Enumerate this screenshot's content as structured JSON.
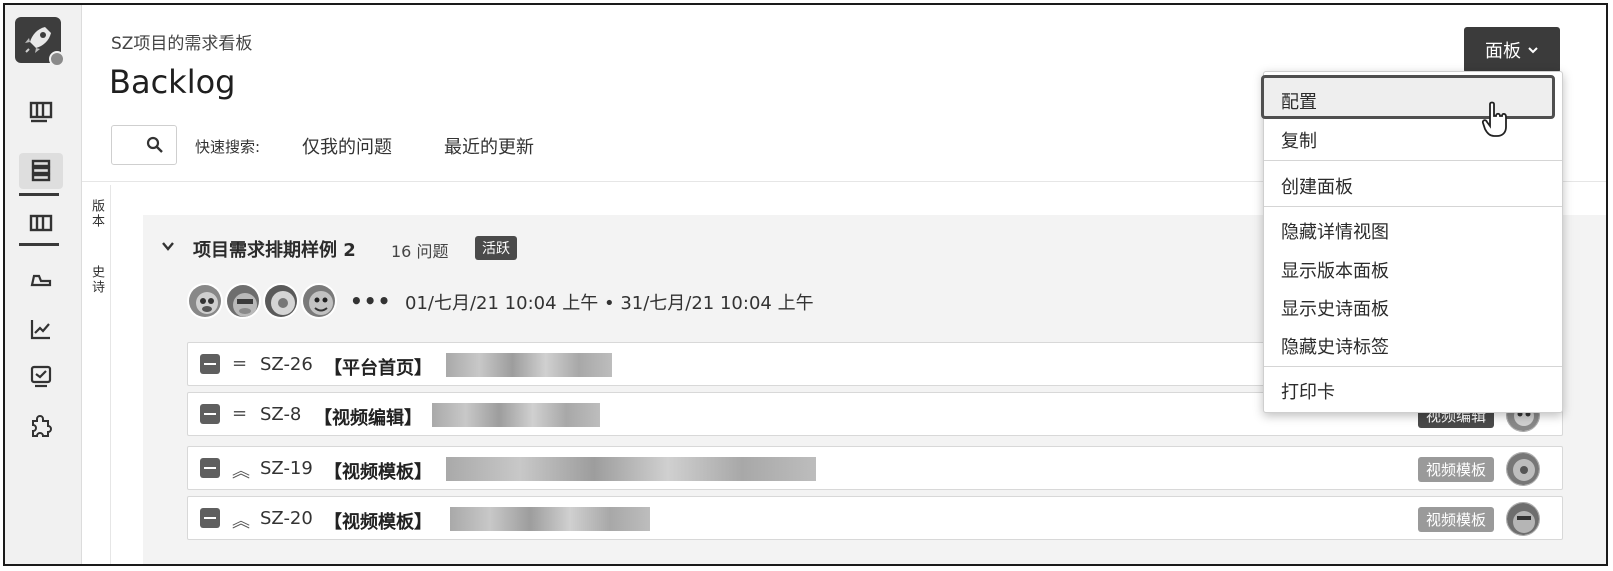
{
  "sidebar": {
    "items": [
      {
        "icon": "board-icon"
      },
      {
        "icon": "backlog-icon",
        "active": true
      },
      {
        "icon": "columns-icon"
      },
      {
        "icon": "releases-icon"
      },
      {
        "icon": "reports-icon"
      },
      {
        "icon": "issues-icon"
      },
      {
        "icon": "addons-icon"
      }
    ]
  },
  "header": {
    "breadcrumb": "SZ项目的需求看板",
    "title": "Backlog",
    "quick_search_label": "快速搜索:",
    "quick_filters": [
      "仅我的问题",
      "最近的更新"
    ],
    "board_button": "面板"
  },
  "vertical_tabs": [
    "版本",
    "史诗"
  ],
  "sprint": {
    "name": "项目需求排期样例 2",
    "issue_count": "16 问题",
    "status": "活跃",
    "more": "•••",
    "dates": "01/七月/21 10:04 上午 • 31/七月/21 10:04 上午"
  },
  "issues": [
    {
      "key": "SZ-26",
      "summary": "【平台首页】",
      "priority": "=",
      "epic": "",
      "epic_style": ""
    },
    {
      "key": "SZ-8",
      "summary": "【视频编辑】",
      "priority": "=",
      "epic": "视频编辑",
      "epic_style": "dark"
    },
    {
      "key": "SZ-19",
      "summary": "【视频模板】",
      "priority": "︽",
      "epic": "视频模板",
      "epic_style": "light"
    },
    {
      "key": "SZ-20",
      "summary": "【视频模板】",
      "priority": "︽",
      "epic": "视频模板",
      "epic_style": "light"
    }
  ],
  "board_menu": {
    "selected": "配置",
    "groups": [
      [
        "配置",
        "复制"
      ],
      [
        "创建面板"
      ],
      [
        "隐藏详情视图",
        "显示版本面板",
        "显示史诗面板",
        "隐藏史诗标签"
      ],
      [
        "打印卡"
      ]
    ]
  },
  "colors": {
    "sidebar_bg": "#f1f1f1",
    "dark_button": "#3b3b3b",
    "sprint_bg": "#f3f3f3"
  }
}
